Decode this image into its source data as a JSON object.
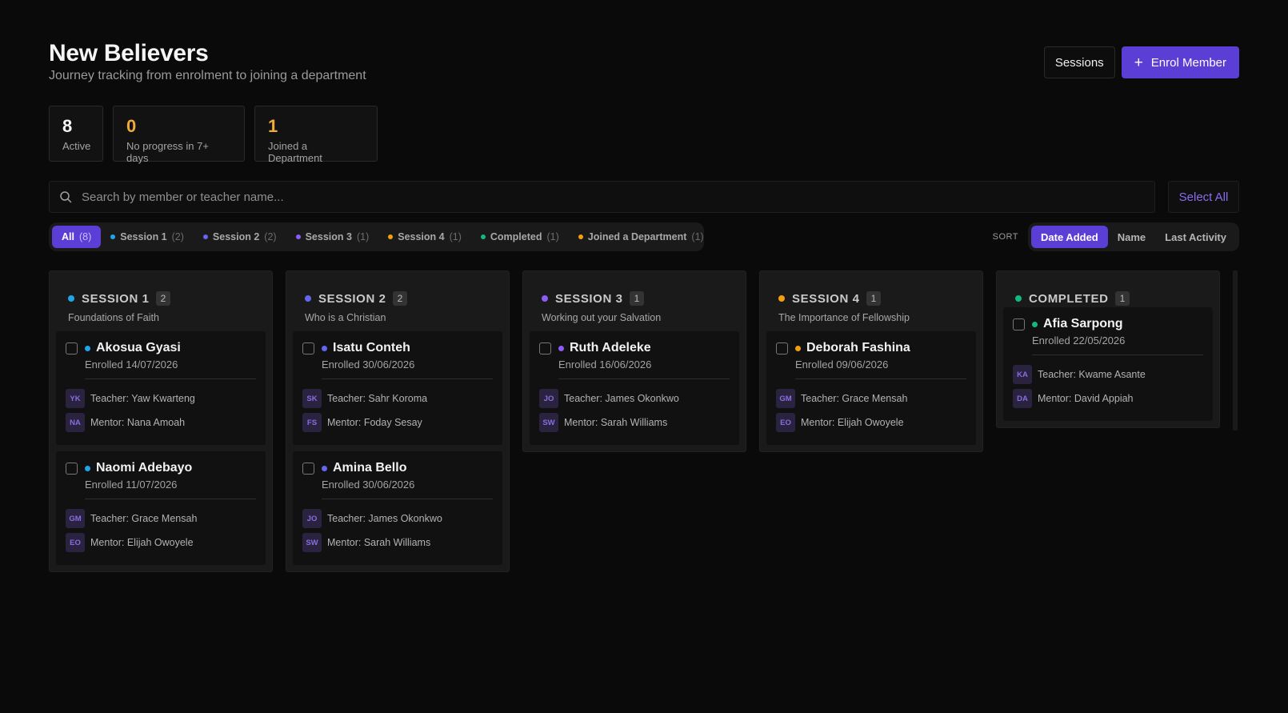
{
  "header": {
    "title": "New Believers",
    "subtitle": "Journey tracking from enrolment to joining a department",
    "sessions_label": "Sessions",
    "enrol_label": "Enrol Member"
  },
  "stats": [
    {
      "value": "8",
      "label": "Active",
      "color": "#f5f5f5"
    },
    {
      "value": "0",
      "label": "No progress in 7+ days",
      "color": "#f0a93a"
    },
    {
      "value": "1",
      "label": "Joined a Department",
      "color": "#f0a93a"
    }
  ],
  "search": {
    "placeholder": "Search by member or teacher name...",
    "value": ""
  },
  "select_all_label": "Select All",
  "filters": [
    {
      "label": "All",
      "count": "(8)",
      "active": true
    },
    {
      "label": "Session 1",
      "count": "(2)",
      "dot": "#1ea7e8"
    },
    {
      "label": "Session 2",
      "count": "(2)",
      "dot": "#6366f1"
    },
    {
      "label": "Session 3",
      "count": "(1)",
      "dot": "#8b5cf6"
    },
    {
      "label": "Session 4",
      "count": "(1)",
      "dot": "#f59e0b"
    },
    {
      "label": "Completed",
      "count": "(1)",
      "dot": "#10b981"
    },
    {
      "label": "Joined a Department",
      "count": "(1)",
      "dot": "#f59e0b"
    }
  ],
  "sort": {
    "label": "SORT",
    "options": [
      "Date Added",
      "Name",
      "Last Activity"
    ],
    "active": "Date Added"
  },
  "columns": [
    {
      "title": "SESSION 1",
      "count": "2",
      "subtitle": "Foundations of Faith",
      "color": "#1ea7e8",
      "cards": [
        {
          "name": "Akosua Gyasi",
          "enrolled": "Enrolled 14/07/2026",
          "teacher_initials": "YK",
          "teacher": "Teacher: Yaw Kwarteng",
          "mentor_initials": "NA",
          "mentor": "Mentor: Nana Amoah"
        },
        {
          "name": "Naomi Adebayo",
          "enrolled": "Enrolled 11/07/2026",
          "teacher_initials": "GM",
          "teacher": "Teacher: Grace Mensah",
          "mentor_initials": "EO",
          "mentor": "Mentor: Elijah Owoyele"
        }
      ]
    },
    {
      "title": "SESSION 2",
      "count": "2",
      "subtitle": "Who is a Christian",
      "color": "#6366f1",
      "cards": [
        {
          "name": "Isatu Conteh",
          "enrolled": "Enrolled 30/06/2026",
          "teacher_initials": "SK",
          "teacher": "Teacher: Sahr Koroma",
          "mentor_initials": "FS",
          "mentor": "Mentor: Foday Sesay"
        },
        {
          "name": "Amina Bello",
          "enrolled": "Enrolled 30/06/2026",
          "teacher_initials": "JO",
          "teacher": "Teacher: James Okonkwo",
          "mentor_initials": "SW",
          "mentor": "Mentor: Sarah Williams"
        }
      ]
    },
    {
      "title": "SESSION 3",
      "count": "1",
      "subtitle": "Working out your Salvation",
      "color": "#8b5cf6",
      "cards": [
        {
          "name": "Ruth Adeleke",
          "enrolled": "Enrolled 16/06/2026",
          "teacher_initials": "JO",
          "teacher": "Teacher: James Okonkwo",
          "mentor_initials": "SW",
          "mentor": "Mentor: Sarah Williams"
        }
      ]
    },
    {
      "title": "SESSION 4",
      "count": "1",
      "subtitle": "The Importance of Fellowship",
      "color": "#f59e0b",
      "cards": [
        {
          "name": "Deborah Fashina",
          "enrolled": "Enrolled 09/06/2026",
          "teacher_initials": "GM",
          "teacher": "Teacher: Grace Mensah",
          "mentor_initials": "EO",
          "mentor": "Mentor: Elijah Owoyele"
        }
      ]
    },
    {
      "title": "COMPLETED",
      "count": "1",
      "subtitle": "",
      "color": "#10b981",
      "cards": [
        {
          "name": "Afia Sarpong",
          "enrolled": "Enrolled 22/05/2026",
          "teacher_initials": "KA",
          "teacher": "Teacher: Kwame Asante",
          "mentor_initials": "DA",
          "mentor": "Mentor: David Appiah"
        }
      ]
    }
  ]
}
